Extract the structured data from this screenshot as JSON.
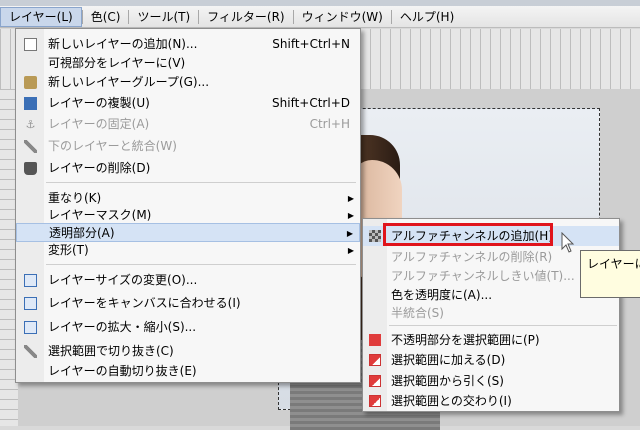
{
  "menubar": {
    "items": [
      "レイヤー(L)",
      "色(C)",
      "ツール(T)",
      "フィルター(R)",
      "ウィンドウ(W)",
      "ヘルプ(H)"
    ],
    "active_index": 0
  },
  "layer_menu": {
    "items": [
      {
        "label": "新しいレイヤーの追加(N)...",
        "shortcut": "Shift+Ctrl+N",
        "icon": "new-layer-icon"
      },
      {
        "label": "可視部分をレイヤーに(V)",
        "shortcut": ""
      },
      {
        "label": "新しいレイヤーグループ(G)...",
        "shortcut": "",
        "icon": "folder-icon"
      },
      {
        "label": "レイヤーの複製(U)",
        "shortcut": "Shift+Ctrl+D",
        "icon": "duplicate-icon"
      },
      {
        "label": "レイヤーの固定(A)",
        "shortcut": "Ctrl+H",
        "icon": "anchor-icon",
        "disabled": true
      },
      {
        "label": "下のレイヤーと統合(W)",
        "shortcut": "",
        "icon": "merge-icon",
        "disabled": true
      },
      {
        "label": "レイヤーの削除(D)",
        "shortcut": "",
        "icon": "trash-icon"
      },
      {
        "label": "重なり(K)",
        "submenu": true
      },
      {
        "label": "レイヤーマスク(M)",
        "submenu": true
      },
      {
        "label": "透明部分(A)",
        "submenu": true,
        "highlighted": true
      },
      {
        "label": "変形(T)",
        "submenu": true
      },
      {
        "label": "レイヤーサイズの変更(O)...",
        "icon": "resize-icon"
      },
      {
        "label": "レイヤーをキャンバスに合わせる(I)",
        "icon": "fit-canvas-icon"
      },
      {
        "label": "レイヤーの拡大・縮小(S)...",
        "icon": "scale-icon"
      },
      {
        "label": "選択範囲で切り抜き(C)",
        "icon": "crop-icon"
      },
      {
        "label": "レイヤーの自動切り抜き(E)"
      }
    ]
  },
  "transparency_submenu": {
    "items": [
      {
        "label": "アルファチャンネルの追加(H)",
        "icon": "checker-icon",
        "highlighted": true
      },
      {
        "label": "アルファチャンネルの削除(R)",
        "disabled": true
      },
      {
        "label": "アルファチャンネルしきい値(T)...",
        "disabled": true
      },
      {
        "label": "色を透明度に(A)..."
      },
      {
        "label": "半統合(S)",
        "disabled": true
      },
      {
        "label": "不透明部分を選択範囲に(P)",
        "icon": "selection-icon"
      },
      {
        "label": "選択範囲に加える(D)",
        "icon": "selection-add-icon"
      },
      {
        "label": "選択範囲から引く(S)",
        "icon": "selection-subtract-icon"
      },
      {
        "label": "選択範囲との交わり(I)",
        "icon": "selection-intersect-icon"
      }
    ]
  },
  "tooltip": {
    "text": "レイヤーに"
  },
  "colors": {
    "highlight": "#d5e3f5",
    "callout_border": "#e0141c",
    "tooltip_bg": "#fffde0"
  }
}
